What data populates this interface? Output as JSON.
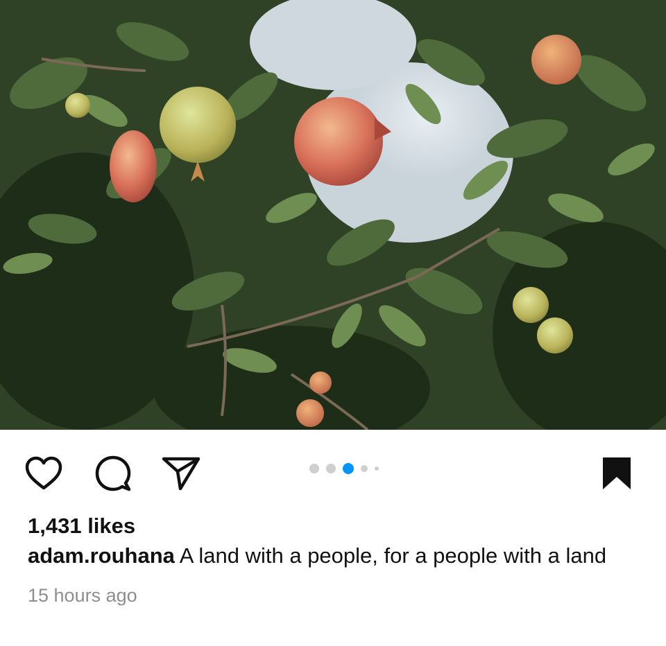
{
  "post": {
    "image_alt": "Pomegranates hanging on a leafy tree branch under a pale sky",
    "likes_text": "1,431 likes",
    "username": "adam.rouhana",
    "caption": "A land with a people, for a people with a land",
    "timestamp": "15 hours ago"
  },
  "carousel": {
    "total": 5,
    "active": 3,
    "active_color": "#0095f6",
    "inactive_color": "#cfcfcf"
  },
  "icons": {
    "like": "heart-icon",
    "comment": "comment-icon",
    "share": "send-icon",
    "save": "bookmark-icon"
  }
}
